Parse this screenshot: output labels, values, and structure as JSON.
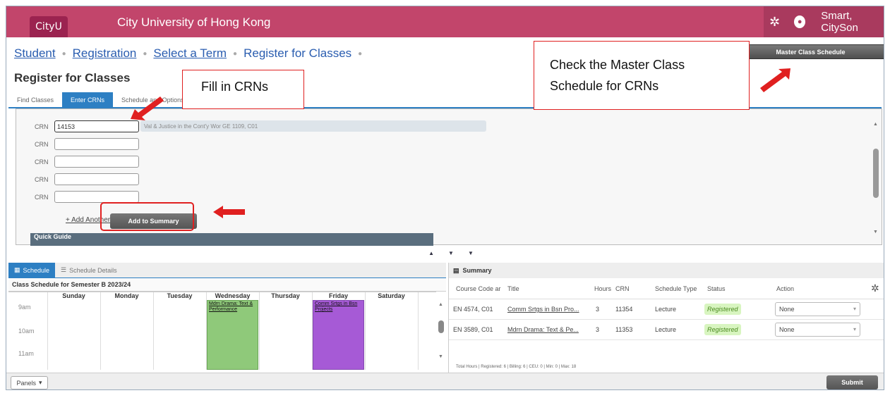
{
  "header": {
    "logo": "CityU",
    "university": "City University of Hong Kong",
    "user": "Smart, CitySon"
  },
  "breadcrumb": [
    "Student",
    "Registration",
    "Select a Term",
    "Register for Classes"
  ],
  "master_class_button": "Master Class Schedule",
  "page_title": "Register for Classes",
  "tabs": [
    "Find Classes",
    "Enter CRNs",
    "Schedule and Options"
  ],
  "crn": {
    "label": "CRN",
    "first_value": "14153",
    "course_hint": "Val & Justice in the Cont'y Wor GE 1109, C01",
    "add_another": "+ Add Another CRN",
    "add_summary": "Add to Summary",
    "quick_guide": "Quick Guide"
  },
  "schedule": {
    "tab_schedule": "Schedule",
    "tab_details": "Schedule Details",
    "title": "Class Schedule for Semester B 2023/24",
    "days": [
      "Sunday",
      "Monday",
      "Tuesday",
      "Wednesday",
      "Thursday",
      "Friday",
      "Saturday"
    ],
    "times": [
      "9am",
      "10am",
      "11am"
    ],
    "events": [
      {
        "day": "Wednesday",
        "label": "Mdrn Drama: Text & Performance",
        "color": "#8fc97a"
      },
      {
        "day": "Friday",
        "label": "Comm Srtgs in Bsn Projects",
        "color": "#a65ad6"
      }
    ]
  },
  "summary": {
    "title": "Summary",
    "columns": [
      "Course Code ar",
      "Title",
      "Hours",
      "CRN",
      "Schedule Type",
      "Status",
      "Action"
    ],
    "rows": [
      {
        "code": "EN 4574, C01",
        "title": "Comm Srtgs in Bsn Pro...",
        "hours": "3",
        "crn": "11354",
        "type": "Lecture",
        "status": "Registered",
        "action": "None"
      },
      {
        "code": "EN 3589, C01",
        "title": "Mdrn Drama: Text & Pe...",
        "hours": "3",
        "crn": "11353",
        "type": "Lecture",
        "status": "Registered",
        "action": "None"
      }
    ],
    "totals": "Total Hours | Registered: 6 | Billing: 6 | CEU: 0 | Min: 0 | Max: 18"
  },
  "footer": {
    "panels": "Panels",
    "submit": "Submit"
  },
  "annotations": {
    "fill_crns": "Fill in CRNs",
    "check_master_1": "Check the Master Class",
    "check_master_2": "Schedule for CRNs"
  },
  "colors": {
    "header": "#c2456b",
    "accent": "#2d7fc3",
    "callout": "#e02020"
  }
}
